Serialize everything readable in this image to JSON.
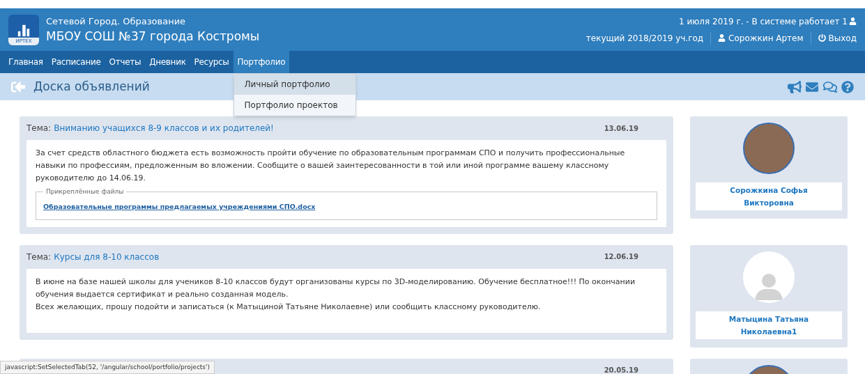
{
  "header": {
    "logo_text": "ИРТЕХ",
    "system_name": "Сетевой Город. Образование",
    "school": "МБОУ СОШ №37 города Костромы",
    "status": "1 июля 2019 г. - В системе работает 1",
    "year": "текущий 2018/2019 уч.год",
    "user": "Сорожкин Артем",
    "logout": "Выход"
  },
  "nav": [
    {
      "label": "Главная",
      "selected": false
    },
    {
      "label": "Расписание",
      "selected": false
    },
    {
      "label": "Отчеты",
      "selected": false
    },
    {
      "label": "Дневник",
      "selected": false
    },
    {
      "label": "Ресурсы",
      "selected": false
    },
    {
      "label": "Портфолио",
      "selected": true
    }
  ],
  "dropdown": [
    {
      "label": "Личный портфолио",
      "selected": true
    },
    {
      "label": "Портфолио проектов",
      "selected": false
    }
  ],
  "page_title": "Доска объявлений",
  "posts": [
    {
      "topic_label": "Тема:",
      "topic": "Вниманию учащихся 8-9 классов и их родителей!",
      "date": "13.06.19",
      "paragraphs": [
        "За счет средств областного бюджета есть возможность пройти обучение по образовательным программам СПО и получить профессиональные навыки по профессиям, предложенным во вложении. Сообщите о вашей заинтересованности в той или иной программе вашему классному руководителю до 14.06.19."
      ],
      "attachments_label": "Прикреплённые файлы",
      "attachments": [
        "Образовательные программы предлагаемых учреждениями СПО.docx"
      ],
      "author": {
        "name": "Сорожкина Софья Викторовна",
        "kind": "photo"
      }
    },
    {
      "topic_label": "Тема:",
      "topic": "Курсы для 8-10 классов",
      "date": "12.06.19",
      "paragraphs": [
        "В июне на базе нашей школы для учеников 8-10 классов будут организованы курсы по 3D-моделированию. Обучение бесплатное!!! По окончании обучения выдается сертификат и реально созданная модель.",
        "Всех желающих, прошу подойти и записаться (к Матыциной Татьяне Николаевне) или сообщить классному руководителю."
      ],
      "author": {
        "name": "Матыцина Татьяна Николаевна1",
        "kind": "default"
      }
    },
    {
      "date": "20.05.19",
      "author": {
        "kind": "photo"
      }
    }
  ],
  "status_bar": "javascript:SetSelectedTab(52, '/angular/school/portfolio/projects')"
}
